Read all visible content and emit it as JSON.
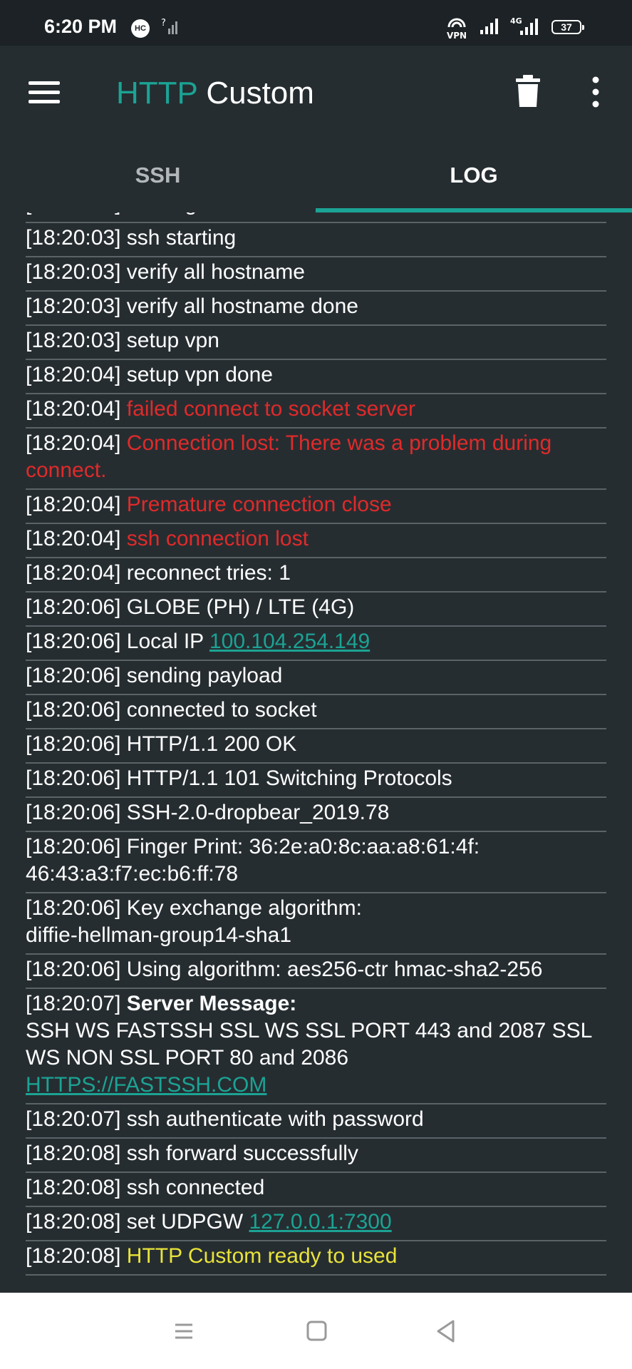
{
  "status_bar": {
    "time": "6:20 PM",
    "hc_badge": "HC",
    "vpn_label": "VPN",
    "network_label": "4G",
    "battery": "37"
  },
  "app_bar": {
    "title_accent": "HTTP",
    "title_main": " Custom",
    "accent_color": "#1ba394"
  },
  "tabs": [
    {
      "label": "SSH",
      "active": false
    },
    {
      "label": "LOG",
      "active": true
    }
  ],
  "log": [
    {
      "time": "[18:20:03]",
      "parts": [
        {
          "text": "starting service",
          "style": "normal"
        }
      ]
    },
    {
      "time": "[18:20:03]",
      "parts": [
        {
          "text": "ssh starting",
          "style": "normal"
        }
      ]
    },
    {
      "time": "[18:20:03]",
      "parts": [
        {
          "text": "verify all hostname",
          "style": "normal"
        }
      ]
    },
    {
      "time": "[18:20:03]",
      "parts": [
        {
          "text": "verify all hostname done",
          "style": "normal"
        }
      ]
    },
    {
      "time": "[18:20:03]",
      "parts": [
        {
          "text": "setup vpn",
          "style": "normal"
        }
      ]
    },
    {
      "time": "[18:20:04]",
      "parts": [
        {
          "text": "setup vpn done",
          "style": "normal"
        }
      ]
    },
    {
      "time": "[18:20:04]",
      "parts": [
        {
          "text": "failed connect to socket server",
          "style": "error"
        }
      ]
    },
    {
      "time": "[18:20:04]",
      "parts": [
        {
          "text": "Connection lost: There was a problem during connect.",
          "style": "error"
        }
      ]
    },
    {
      "time": "[18:20:04]",
      "parts": [
        {
          "text": "Premature connection close",
          "style": "error"
        }
      ]
    },
    {
      "time": "[18:20:04]",
      "parts": [
        {
          "text": "ssh connection lost",
          "style": "error"
        }
      ]
    },
    {
      "time": "[18:20:04]",
      "parts": [
        {
          "text": "reconnect tries: 1",
          "style": "normal"
        }
      ]
    },
    {
      "time": "[18:20:06]",
      "parts": [
        {
          "text": "GLOBE (PH) / LTE (4G)",
          "style": "normal"
        }
      ]
    },
    {
      "time": "[18:20:06]",
      "parts": [
        {
          "text": "Local IP ",
          "style": "normal"
        },
        {
          "text": "100.104.254.149",
          "style": "link"
        }
      ]
    },
    {
      "time": "[18:20:06]",
      "parts": [
        {
          "text": "sending payload",
          "style": "normal"
        }
      ]
    },
    {
      "time": "[18:20:06]",
      "parts": [
        {
          "text": "connected to socket",
          "style": "normal"
        }
      ]
    },
    {
      "time": "[18:20:06]",
      "parts": [
        {
          "text": "HTTP/1.1 200 OK",
          "style": "normal"
        }
      ]
    },
    {
      "time": "[18:20:06]",
      "parts": [
        {
          "text": "HTTP/1.1 101 Switching Protocols",
          "style": "normal"
        }
      ]
    },
    {
      "time": "[18:20:06]",
      "parts": [
        {
          "text": "SSH-2.0-dropbear_2019.78",
          "style": "normal"
        }
      ]
    },
    {
      "time": "[18:20:06]",
      "parts": [
        {
          "text": "Finger Print: 36:2e:a0:8c:aa:a8:61:4f:",
          "style": "normal"
        },
        {
          "text": "46:43:a3:f7:ec:b6:ff:78",
          "style": "normal",
          "break_before": true
        }
      ]
    },
    {
      "time": "[18:20:06]",
      "parts": [
        {
          "text": "Key exchange algorithm:",
          "style": "normal"
        },
        {
          "text": "diffie-hellman-group14-sha1",
          "style": "normal",
          "break_before": true
        }
      ]
    },
    {
      "time": "[18:20:06]",
      "parts": [
        {
          "text": "Using algorithm: aes256-ctr hmac-sha2-256",
          "style": "normal"
        }
      ]
    },
    {
      "time": "[18:20:07]",
      "parts": [
        {
          "text": "Server Message:",
          "style": "bold"
        },
        {
          "text": "SSH WS FASTSSH SSL WS SSL PORT 443 and 2087 SSL WS NON SSL PORT 80 and 2086",
          "style": "normal",
          "break_before": true
        },
        {
          "text": "HTTPS://FASTSSH.COM",
          "style": "link",
          "break_before": true
        }
      ]
    },
    {
      "time": "[18:20:07]",
      "parts": [
        {
          "text": "ssh authenticate with password",
          "style": "normal"
        }
      ]
    },
    {
      "time": "[18:20:08]",
      "parts": [
        {
          "text": "ssh forward successfully",
          "style": "normal"
        }
      ]
    },
    {
      "time": "[18:20:08]",
      "parts": [
        {
          "text": "ssh connected",
          "style": "normal"
        }
      ]
    },
    {
      "time": "[18:20:08]",
      "parts": [
        {
          "text": "set UDPGW ",
          "style": "normal"
        },
        {
          "text": "127.0.0.1:7300",
          "style": "link"
        }
      ]
    },
    {
      "time": "[18:20:08]",
      "parts": [
        {
          "text": "HTTP Custom ready to used",
          "style": "success"
        }
      ]
    }
  ],
  "icons": {
    "menu": "hamburger-menu-icon",
    "trash": "trash-icon",
    "more": "more-vert-icon",
    "nav_recents": "recents-icon",
    "nav_home": "home-icon",
    "nav_back": "back-icon"
  },
  "colors": {
    "background": "#262d31",
    "app_bar": "#252d31",
    "accent": "#1ba394",
    "error": "#e02a2a",
    "success": "#e8e33a",
    "divider": "#5a6367"
  }
}
